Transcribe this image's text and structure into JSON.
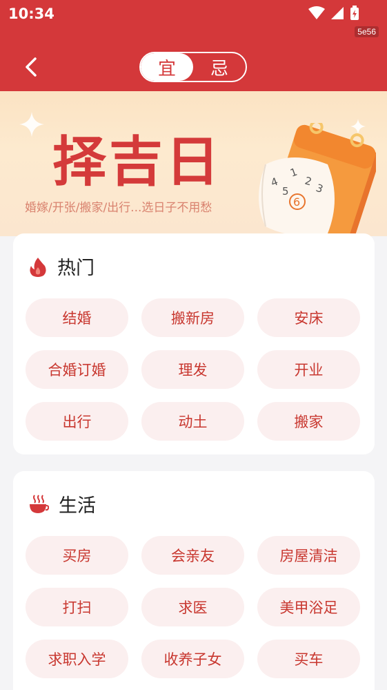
{
  "status_bar": {
    "time": "10:34",
    "code": "5e56"
  },
  "header": {
    "tabs": [
      {
        "label": "宜",
        "active": true
      },
      {
        "label": "忌",
        "active": false
      }
    ],
    "accent": "#d4383a"
  },
  "banner": {
    "title": "择吉日",
    "subtitle": "婚嫁/开张/搬家/出行...选日子不用愁",
    "calendar_numbers": [
      "1",
      "2",
      "3",
      "4",
      "5",
      "6"
    ]
  },
  "sections": [
    {
      "title": "热门",
      "icon": "fire-icon",
      "items": [
        "结婚",
        "搬新房",
        "安床",
        "合婚订婚",
        "理发",
        "开业",
        "出行",
        "动土",
        "搬家"
      ]
    },
    {
      "title": "生活",
      "icon": "teacup-icon",
      "items": [
        "买房",
        "会亲友",
        "房屋清洁",
        "打扫",
        "求医",
        "美甲浴足",
        "求职入学",
        "收养子女",
        "买车"
      ]
    }
  ],
  "colors": {
    "chip_bg": "#fbefef",
    "chip_text": "#c8372f",
    "page_bg": "#f4f4f6"
  }
}
